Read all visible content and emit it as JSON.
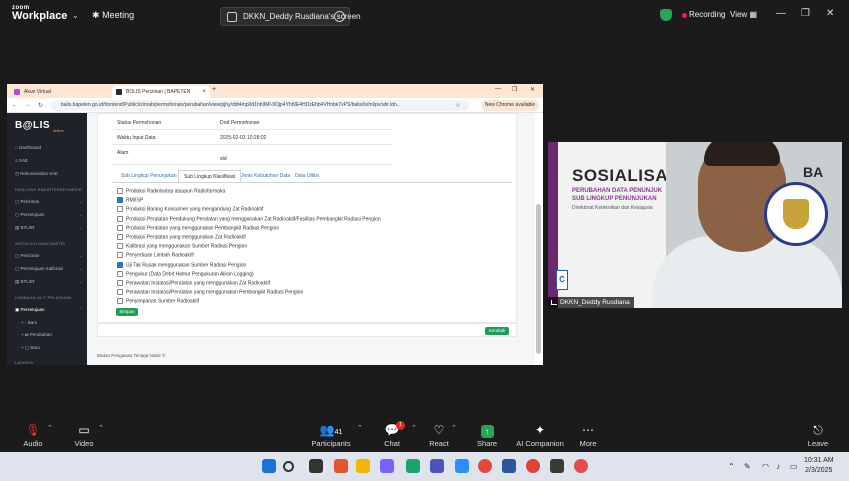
{
  "zoom": {
    "logo_small": "zoom",
    "logo_big": "Workplace",
    "meeting_label": "Meeting",
    "share_label": "DKKN_Deddy Rusdiana's screen",
    "recording_label": "Recording",
    "view_label": "View"
  },
  "browser": {
    "tabs": [
      {
        "label": "Akun Virtual",
        "color": "#b04fd6"
      },
      {
        "label": "BOLIS Perizinan | BAPETEN",
        "color": "#2a2a2a"
      }
    ],
    "url": "balis.bapeten.go.id/frontend/Public/izinrab/permohonan/perubahan/view/pjhy/ddt4mp0d1hh9Ml-9Ojp4Yht9E4HDzEhb4VHnbk7vPS/balis/ls/ml/pv/ubr.ldn..",
    "chrome_pill": "New Chrome available"
  },
  "sidebar": {
    "logo": "B@LIS",
    "logo_sub": "online",
    "items_top": [
      "Dashboard",
      "SAE",
      "Rekomendasi SAE"
    ],
    "head1": "FASILITAS RADIOTERAPI MEDIS",
    "items_mid": [
      "Perizinan",
      "Persetujuan",
      "BTL/IR"
    ],
    "head2": "INSTALASI RADIOMETRI",
    "items_low": [
      "Perizinan",
      "Persetujuan Kalibrasi",
      "BTL/IR"
    ],
    "head3": "LEMBAGA ULIT PELATIHAN",
    "items_bottom": [
      "Persetujuan",
      "Baru",
      "Perubahan",
      "Baru"
    ],
    "last": "LAINNYA"
  },
  "details": {
    "rows": [
      {
        "key": "Status Permohonan",
        "value": "Draf Permohonan"
      },
      {
        "key": "Waktu Input Data",
        "value": "2025-02-03 10:28:02"
      },
      {
        "key": "Alam",
        "value": "std"
      }
    ]
  },
  "subtabs": [
    "Sub Lingkup Penunjukan",
    "Sub Lingkup Klasifikasi",
    "Jenis Kebutuhan Data",
    "Data Utilisi"
  ],
  "checkboxes": [
    {
      "label": "Produksi Radioisotop ataupun Radiofarmaka",
      "checked": false
    },
    {
      "label": "RM/ISP",
      "checked": true
    },
    {
      "label": "Produksi Barang Konsumen yang mengandung Zat Radioaktif",
      "checked": false
    },
    {
      "label": "Produksi Peralatan Pendukung Peralatan yang menggunakan Zat Radioaktif/Fasilitas Pembangkit Radiasi Pengion",
      "checked": false
    },
    {
      "label": "Produksi Peralatan yang menggunakan Pembangkit Radiasi Pengion",
      "checked": false
    },
    {
      "label": "Produksi Peralatan yang menggunakan Zat Radioaktif",
      "checked": false
    },
    {
      "label": "Kalibrasi yang menggunakan Sumber Radiasi Pengion",
      "checked": false
    },
    {
      "label": "Penyediaan Limbah Radioaktif",
      "checked": false
    },
    {
      "label": "Uji Tak Rusak menggunakan Sumber Radiasi Pengion",
      "checked": true
    },
    {
      "label": "Pengukur (Data Debit Hamur Pengukuran Aliran Logging)",
      "checked": false
    },
    {
      "label": "Perawatan Instalasi/Peralatan yang menggunakan Zat Radioaktif",
      "checked": false
    },
    {
      "label": "Perawatan Instalasi/Peralatan yang menggunakan Pembangkit Radiasi Pengion",
      "checked": false
    },
    {
      "label": "Penyimpanan Sumber Radioaktif",
      "checked": false
    }
  ],
  "buttons": {
    "save": "Simpan",
    "next": "Kembali"
  },
  "footer": "Badan Pengawas Tenaga Nuklir ©",
  "video": {
    "banner_title": "SOSIALISASI",
    "banner_title_tail": "BA",
    "banner_sub1": "PERUBAHAN DATA PENUNJUK",
    "banner_sub2": "SUB LINGKUP PENUNJUKAN",
    "banner_sub3": "Direktorat Keteknikan dan Kesiapsia",
    "participant_name": "DKKN_Deddy Rusdiana",
    "side_logo": "C"
  },
  "toolbar": {
    "audio": "Audio",
    "video": "Video",
    "participants": "Participants",
    "participants_count": "41",
    "chat": "Chat",
    "chat_badge": "1",
    "react": "React",
    "share": "Share",
    "ai": "AI Companion",
    "more": "More",
    "leave": "Leave"
  },
  "taskbar": {
    "time": "10:31 AM",
    "date": "2/3/2025"
  },
  "colors": {
    "accent": "#1f9d55",
    "record": "#e22244",
    "share_green": "#23a55a"
  }
}
